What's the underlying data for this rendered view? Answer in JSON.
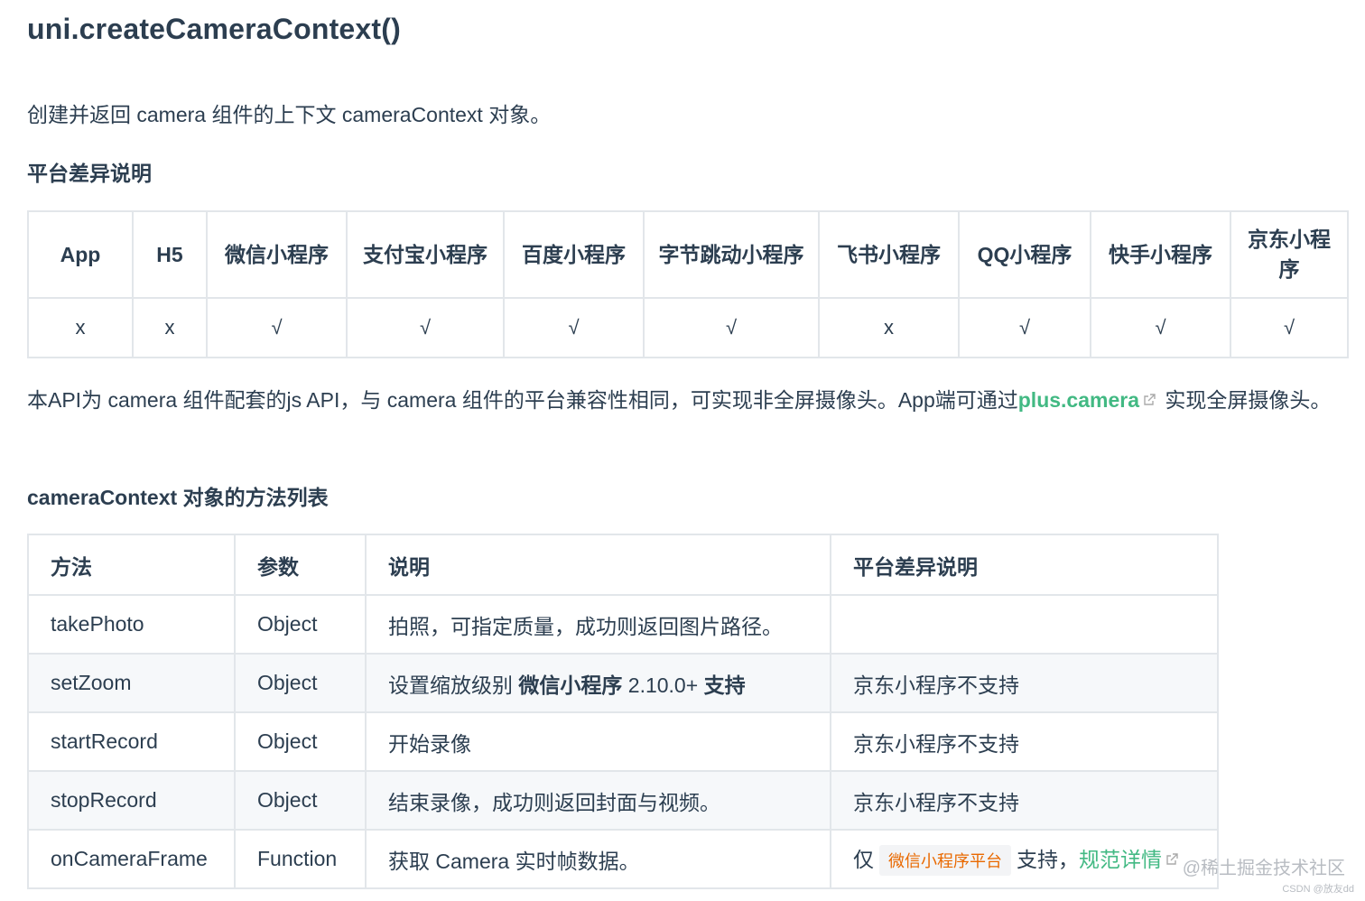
{
  "title": "uni.createCameraContext()",
  "intro": "创建并返回 camera 组件的上下文 cameraContext 对象。",
  "platform_heading": "平台差异说明",
  "platform_table": {
    "headers": [
      "App",
      "H5",
      "微信小程序",
      "支付宝小程序",
      "百度小程序",
      "字节跳动小程序",
      "飞书小程序",
      "QQ小程序",
      "快手小程序",
      "京东小程序"
    ],
    "values": [
      "x",
      "x",
      "√",
      "√",
      "√",
      "√",
      "x",
      "√",
      "√",
      "√"
    ]
  },
  "note": {
    "before": "本API为 camera 组件配套的js API，与 camera 组件的平台兼容性相同，可实现非全屏摄像头。App端可通过",
    "link": "plus.camera",
    "after": " 实现全屏摄像头。"
  },
  "methods_heading": "cameraContext 对象的方法列表",
  "methods_table": {
    "headers": [
      "方法",
      "参数",
      "说明",
      "平台差异说明"
    ],
    "rows": [
      {
        "method": "takePhoto",
        "param": "Object",
        "desc": "拍照，可指定质量，成功则返回图片路径。",
        "platform": ""
      },
      {
        "method": "setZoom",
        "param": "Object",
        "desc_prefix": "设置缩放级别 ",
        "desc_bold1": "微信小程序",
        "desc_mid": " 2.10.0+ ",
        "desc_bold2": "支持",
        "platform": "京东小程序不支持"
      },
      {
        "method": "startRecord",
        "param": "Object",
        "desc": "开始录像",
        "platform": "京东小程序不支持"
      },
      {
        "method": "stopRecord",
        "param": "Object",
        "desc": "结束录像，成功则返回封面与视频。",
        "platform": "京东小程序不支持"
      },
      {
        "method": "onCameraFrame",
        "param": "Function",
        "desc": "获取 Camera 实时帧数据。",
        "platform_prefix": "仅",
        "platform_tag": "微信小程序平台",
        "platform_mid": "支持，",
        "platform_link": "规范详情"
      }
    ]
  },
  "watermark": "@稀土掘金技术社区",
  "csdn": "CSDN @放友dd",
  "colors": {
    "text": "#2c3e50",
    "link": "#42b983",
    "tag": "#e96900",
    "border": "#e2e6ea",
    "stripe": "#f6f8fa"
  }
}
